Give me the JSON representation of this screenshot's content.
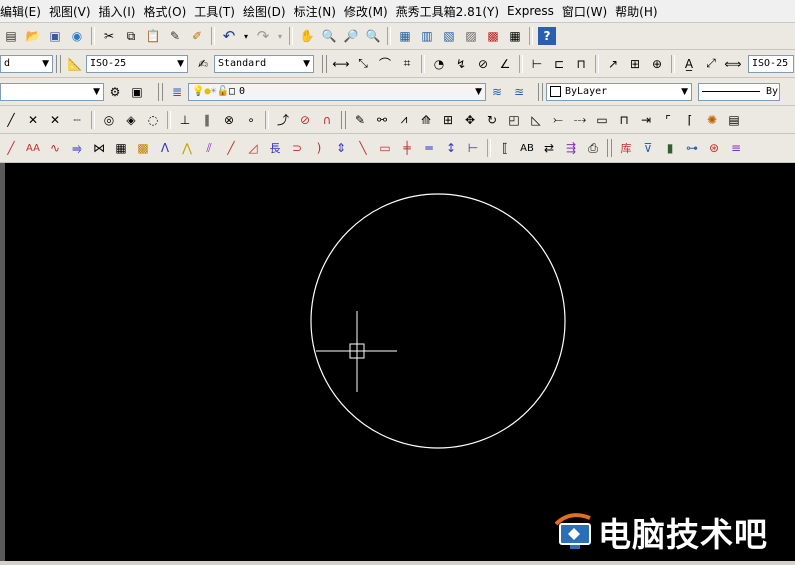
{
  "menu": [
    "编辑(E)",
    "视图(V)",
    "插入(I)",
    "格式(O)",
    "工具(T)",
    "绘图(D)",
    "标注(N)",
    "修改(M)",
    "燕秀工具箱2.81(Y)",
    "Express",
    "窗口(W)",
    "帮助(H)"
  ],
  "row2": {
    "left_fragment": "d",
    "dimstyle": "ISO-25",
    "textstyle": "Standard",
    "dimstyle_right": "ISO-25"
  },
  "row3": {
    "layer": "0",
    "color": "ByLayer",
    "linetype": "By"
  },
  "icons": {
    "undo": "undo-icon",
    "redo": "redo-icon",
    "help": "help-icon"
  },
  "watermark": "电脑技术吧",
  "colors": {
    "canvas": "#000000",
    "toolbar": "#ece9e2",
    "drawing": "#ffffff"
  }
}
